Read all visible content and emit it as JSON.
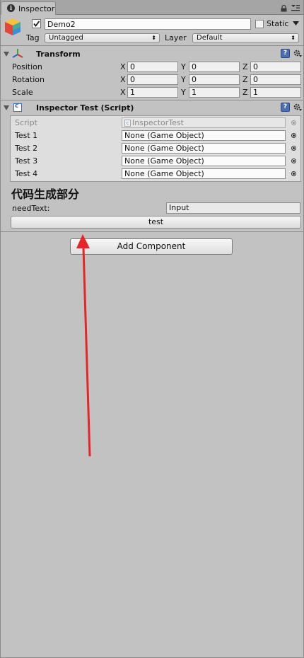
{
  "window": {
    "tab_title": "Inspector"
  },
  "object": {
    "name": "Demo2",
    "static_label": "Static"
  },
  "tag_row": {
    "tag_label": "Tag",
    "tag_value": "Untagged",
    "layer_label": "Layer",
    "layer_value": "Default"
  },
  "transform": {
    "title": "Transform",
    "rows": [
      {
        "label": "Position",
        "x": "0",
        "y": "0",
        "z": "0"
      },
      {
        "label": "Rotation",
        "x": "0",
        "y": "0",
        "z": "0"
      },
      {
        "label": "Scale",
        "x": "1",
        "y": "1",
        "z": "1"
      }
    ],
    "axis_x": "X",
    "axis_y": "Y",
    "axis_z": "Z"
  },
  "script_component": {
    "title": "Inspector Test (Script)",
    "script_label": "Script",
    "script_value": "InspectorTest",
    "fields": [
      {
        "label": "Test 1",
        "value": "None (Game Object)"
      },
      {
        "label": "Test 2",
        "value": "None (Game Object)"
      },
      {
        "label": "Test 3",
        "value": "None (Game Object)"
      },
      {
        "label": "Test 4",
        "value": "None (Game Object)"
      }
    ],
    "section_heading": "代码生成部分",
    "need_text_label": "needText:",
    "need_text_value": "Input",
    "test_button": "test"
  },
  "add_component_button": "Add Component",
  "colors": {
    "background": "#c2c2c2",
    "arrow": "#e8232a",
    "help_icon": "#4d6fb0"
  }
}
